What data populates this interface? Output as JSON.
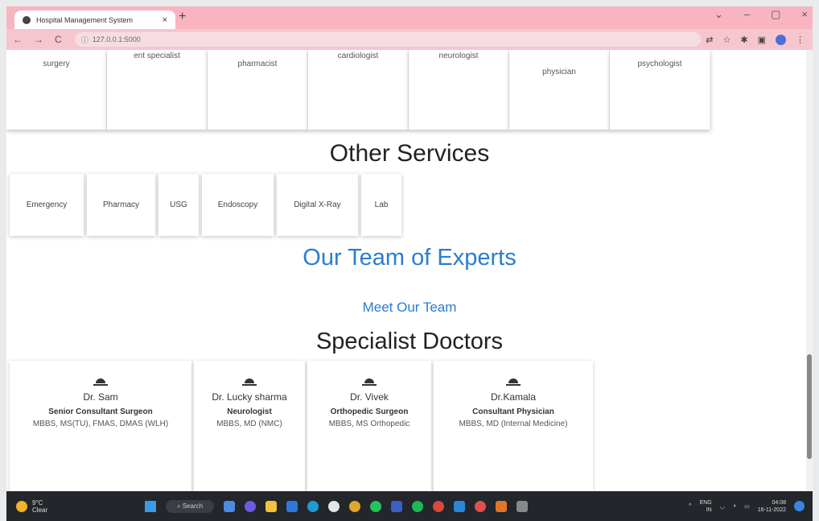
{
  "browser": {
    "tab_title": "Hospital Management System",
    "tab_close": "×",
    "new_tab": "+",
    "url": "127.0.0.1:5000",
    "window_controls": [
      "⌄",
      "–",
      "▢",
      "×"
    ]
  },
  "specialists": [
    "surgery",
    "ent specialist",
    "pharmacist",
    "cardiologist",
    "neurologist",
    "physician",
    "psychologist"
  ],
  "services": {
    "title": "Other Services",
    "items": [
      "Emergency",
      "Pharmacy",
      "USG",
      "Endoscopy",
      "Digital X-Ray",
      "Lab"
    ]
  },
  "team": {
    "title": "Our Team of Experts",
    "link": "Meet Our Team"
  },
  "doctors": {
    "title": "Specialist Doctors",
    "items": [
      {
        "name": "Dr. Sam",
        "role": "Senior Consultant Surgeon",
        "degree": "MBBS, MS(TU), FMAS, DMAS (WLH)"
      },
      {
        "name": "Dr. Lucky sharma",
        "role": "Neurologist",
        "degree": "MBBS, MD (NMC)"
      },
      {
        "name": "Dr. Vivek",
        "role": "Orthopedic Surgeon",
        "degree": "MBBS, MS Orthopedic"
      },
      {
        "name": "Dr.Kamala",
        "role": "Consultant Physician",
        "degree": "MBBS, MD (Internal Medicine)"
      }
    ]
  },
  "taskbar": {
    "weather_temp": "9°C",
    "weather_desc": "Clear",
    "search": "Search",
    "lang": "ENG",
    "region": "IN",
    "time": "04:08",
    "date": "16-11-2022"
  },
  "colors": {
    "tabbar": "#f8b4c1",
    "accent": "#2a7dd0",
    "taskbar": "#23262b"
  }
}
